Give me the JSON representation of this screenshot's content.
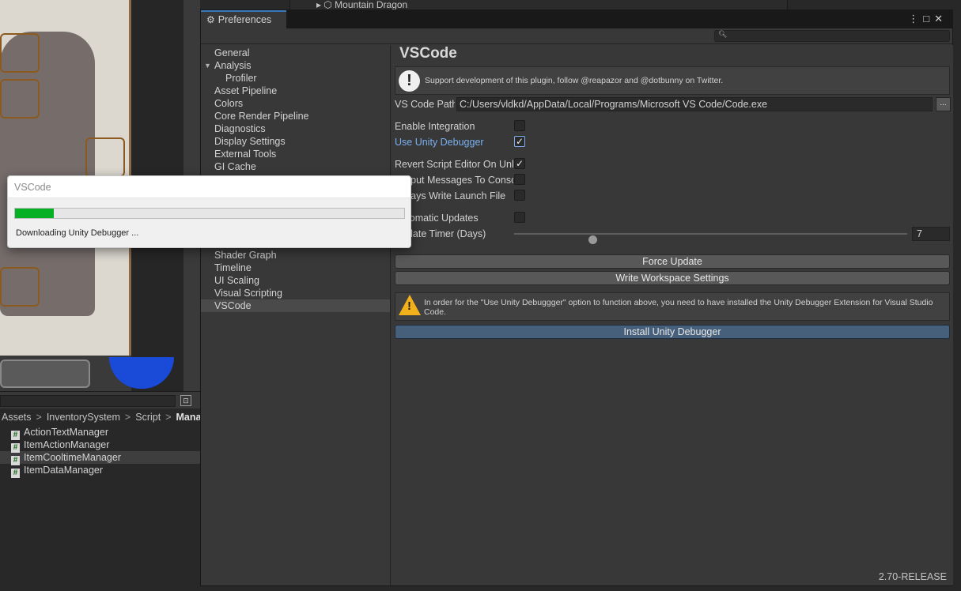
{
  "background": {
    "hierarchy_item": "Mountain Dragon",
    "project": {
      "breadcrumb": [
        "Assets",
        "InventorySystem",
        "Script",
        "Manager"
      ],
      "files": [
        {
          "name": "ActionTextManager",
          "selected": false
        },
        {
          "name": "ItemActionManager",
          "selected": false
        },
        {
          "name": "ItemCooltimeManager",
          "selected": true
        },
        {
          "name": "ItemDataManager",
          "selected": false
        }
      ]
    }
  },
  "window": {
    "tab_title": "Preferences",
    "menu_icon": "kebab-menu-icon",
    "maximize_icon": "maximize-icon",
    "close_icon": "close-icon"
  },
  "sidebar": {
    "items": [
      {
        "label": "General",
        "level": 0,
        "selected": false
      },
      {
        "label": "Analysis",
        "level": 0,
        "expanded": true,
        "selected": false
      },
      {
        "label": "Profiler",
        "level": 1,
        "selected": false
      },
      {
        "label": "Asset Pipeline",
        "level": 0,
        "selected": false
      },
      {
        "label": "Colors",
        "level": 0,
        "selected": false
      },
      {
        "label": "Core Render Pipeline",
        "level": 0,
        "selected": false
      },
      {
        "label": "Diagnostics",
        "level": 0,
        "selected": false
      },
      {
        "label": "Display Settings",
        "level": 0,
        "selected": false
      },
      {
        "label": "External Tools",
        "level": 0,
        "selected": false
      },
      {
        "label": "GI Cache",
        "level": 0,
        "selected": false
      },
      {
        "label": "Shader Graph",
        "level": 0,
        "selected": false
      },
      {
        "label": "Timeline",
        "level": 0,
        "selected": false
      },
      {
        "label": "UI Scaling",
        "level": 0,
        "selected": false
      },
      {
        "label": "Visual Scripting",
        "level": 0,
        "selected": false
      },
      {
        "label": "VSCode",
        "level": 0,
        "selected": true
      }
    ]
  },
  "content": {
    "title": "VSCode",
    "support_message": "Support development of this plugin, follow @reapazor and @dotbunny on Twitter.",
    "vscode_path_label": "VS Code Path",
    "vscode_path_value": "C:/Users/vldkd/AppData/Local/Programs/Microsoft VS Code/Code.exe",
    "browse_label": "...",
    "settings": [
      {
        "label": "Enable Integration",
        "checked": false
      },
      {
        "label": "Use Unity Debugger",
        "checked": true,
        "highlight": true
      },
      {
        "label": "Revert Script Editor On Unload",
        "checked": true
      },
      {
        "label": "Output Messages To Console",
        "checked": false
      },
      {
        "label": "Always Write Launch File",
        "checked": false
      },
      {
        "label": "Automatic Updates",
        "checked": false
      }
    ],
    "update_timer_label": "Update Timer (Days)",
    "update_timer_value": "7",
    "update_timer_fraction": 0.2,
    "force_update_label": "Force Update",
    "write_workspace_label": "Write Workspace Settings",
    "warning_message": "In order for the \"Use Unity Debuggger\" option to function above, you need to have installed the Unity Debugger Extension for Visual Studio Code.",
    "install_debugger_label": "Install Unity Debugger",
    "version": "2.70-RELEASE"
  },
  "dialog": {
    "title": "VSCode",
    "message": "Downloading Unity Debugger ...",
    "progress": 0.1,
    "progress_color": "#06b025"
  },
  "colors": {
    "accent": "#3a79bb",
    "link": "#7ab0f0",
    "warning": "#f2b11a"
  }
}
